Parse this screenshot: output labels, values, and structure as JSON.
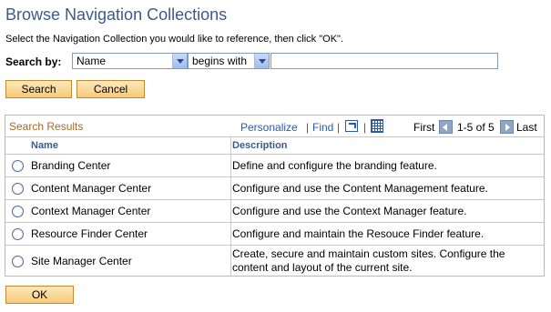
{
  "page": {
    "title": "Browse Navigation Collections",
    "instructions": "Select the Navigation Collection you would like to reference, then click \"OK\"."
  },
  "search": {
    "label": "Search by:",
    "field_selected": "Name",
    "operator_selected": "begins with",
    "value": "",
    "search_button": "Search",
    "cancel_button": "Cancel"
  },
  "grid": {
    "title": "Search Results",
    "personalize": "Personalize",
    "find": "Find",
    "first": "First",
    "range": "1-5 of 5",
    "last": "Last",
    "columns": {
      "name": "Name",
      "description": "Description"
    },
    "rows": [
      {
        "name": "Branding Center",
        "description": "Define and configure the branding feature."
      },
      {
        "name": "Content Manager Center",
        "description": "Configure and use the Content Management feature."
      },
      {
        "name": "Context Manager Center",
        "description": "Configure and use the Context Manager feature."
      },
      {
        "name": "Resource Finder Center",
        "description": "Configure and maintain the Resouce Finder feature."
      },
      {
        "name": "Site Manager Center",
        "description": "Create, secure and maintain custom sites.  Configure the content and layout of the current site."
      }
    ]
  },
  "footer": {
    "ok_button": "OK"
  },
  "colors": {
    "title": "#3c5a8c",
    "link": "#2a5aa8",
    "grid_title": "#a36b2b",
    "button_bg": "#f8c978"
  }
}
